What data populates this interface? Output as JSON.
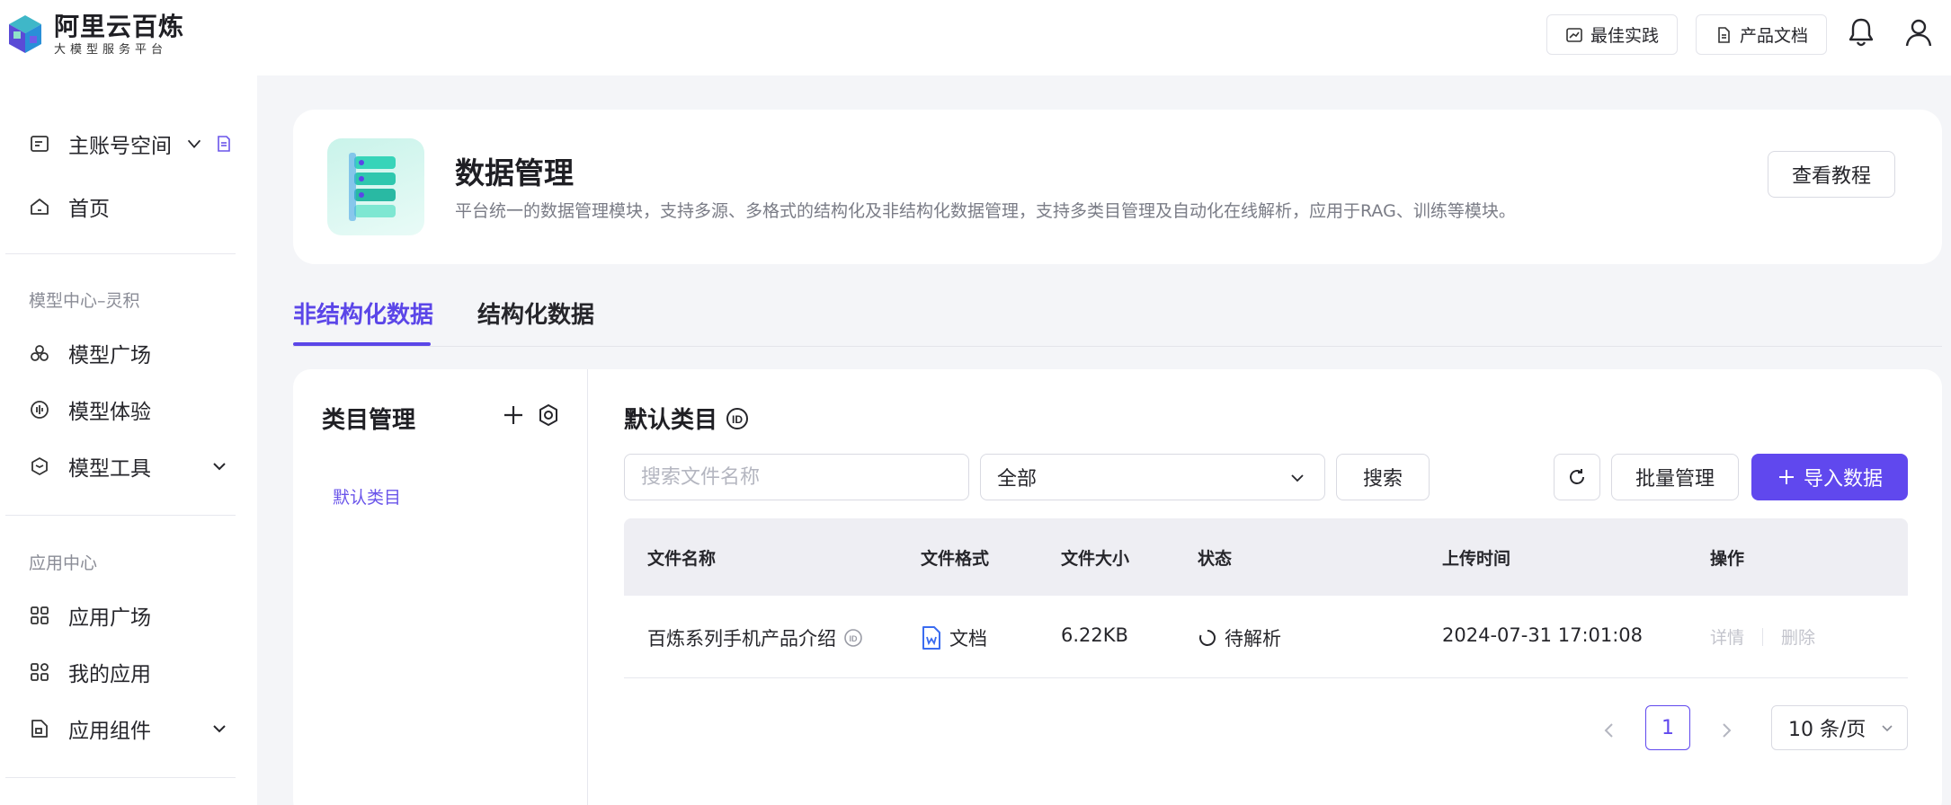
{
  "brand": {
    "title": "阿里云百炼",
    "subtitle": "大模型服务平台"
  },
  "topbar": {
    "best_practice": "最佳实践",
    "product_docs": "产品文档",
    "icons": [
      "bell-icon",
      "user-icon"
    ]
  },
  "sidebar": {
    "workspace": "主账号空间",
    "home": "首页",
    "section_model": "模型中心–灵积",
    "model_items": [
      "模型广场",
      "模型体验",
      "模型工具"
    ],
    "section_app": "应用中心",
    "app_items": [
      "应用广场",
      "我的应用",
      "应用组件"
    ]
  },
  "header": {
    "title": "数据管理",
    "description": "平台统一的数据管理模块，支持多源、多格式的结构化及非结构化数据管理，支持多类目管理及自动化在线解析，应用于RAG、训练等模块。",
    "tutorial_button": "查看教程"
  },
  "tabs": {
    "unstructured": "非结构化数据",
    "structured": "结构化数据",
    "active": "非结构化数据"
  },
  "category": {
    "title": "类目管理",
    "items": [
      "默认类目"
    ]
  },
  "main": {
    "title": "默认类目",
    "search_placeholder": "搜索文件名称",
    "filter_value": "全部",
    "search_button": "搜索",
    "batch_button": "批量管理",
    "import_button": "导入数据"
  },
  "table": {
    "headers": [
      "文件名称",
      "文件格式",
      "文件大小",
      "状态",
      "上传时间",
      "操作"
    ],
    "rows": [
      {
        "name": "百炼系列手机产品介绍",
        "format": "文档",
        "size": "6.22KB",
        "status": "待解析",
        "uploaded": "2024-07-31 17:01:08",
        "action_detail": "详情",
        "action_delete": "删除"
      }
    ]
  },
  "pagination": {
    "current_page": "1",
    "page_size": "10 条/页"
  },
  "colors": {
    "accent": "#6048ee",
    "tab_active": "#5b46e8",
    "category_item": "#6a55ea",
    "doc_icon": "#3b6cf0"
  }
}
